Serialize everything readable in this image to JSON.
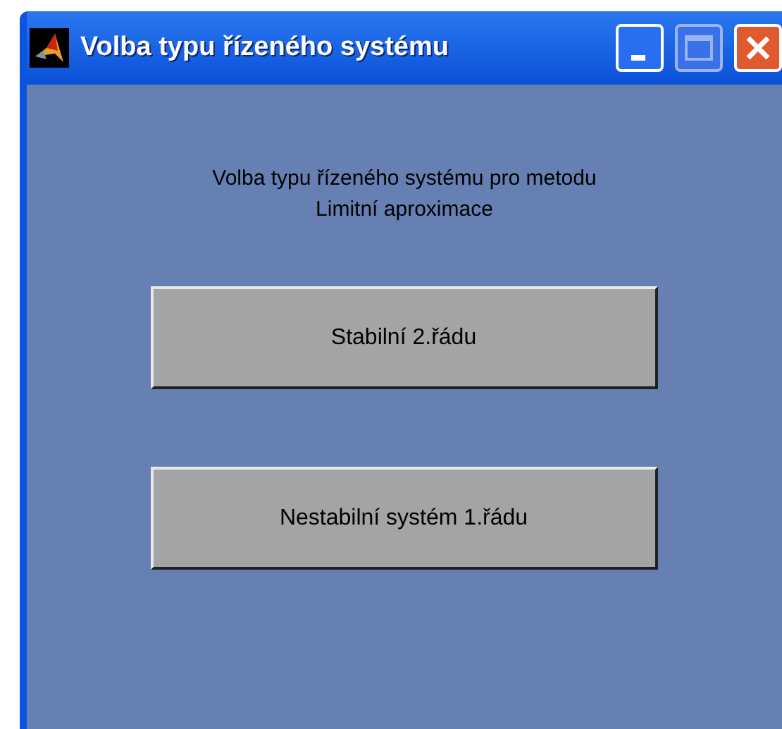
{
  "window": {
    "title": "Volba typu řízeného systému"
  },
  "prompt": [
    "Volba typu řízeného systému pro metodu",
    "Limitní aproximace"
  ],
  "buttons": [
    "Stabilní 2.řádu",
    "Nestabilní systém 1.řádu"
  ]
}
